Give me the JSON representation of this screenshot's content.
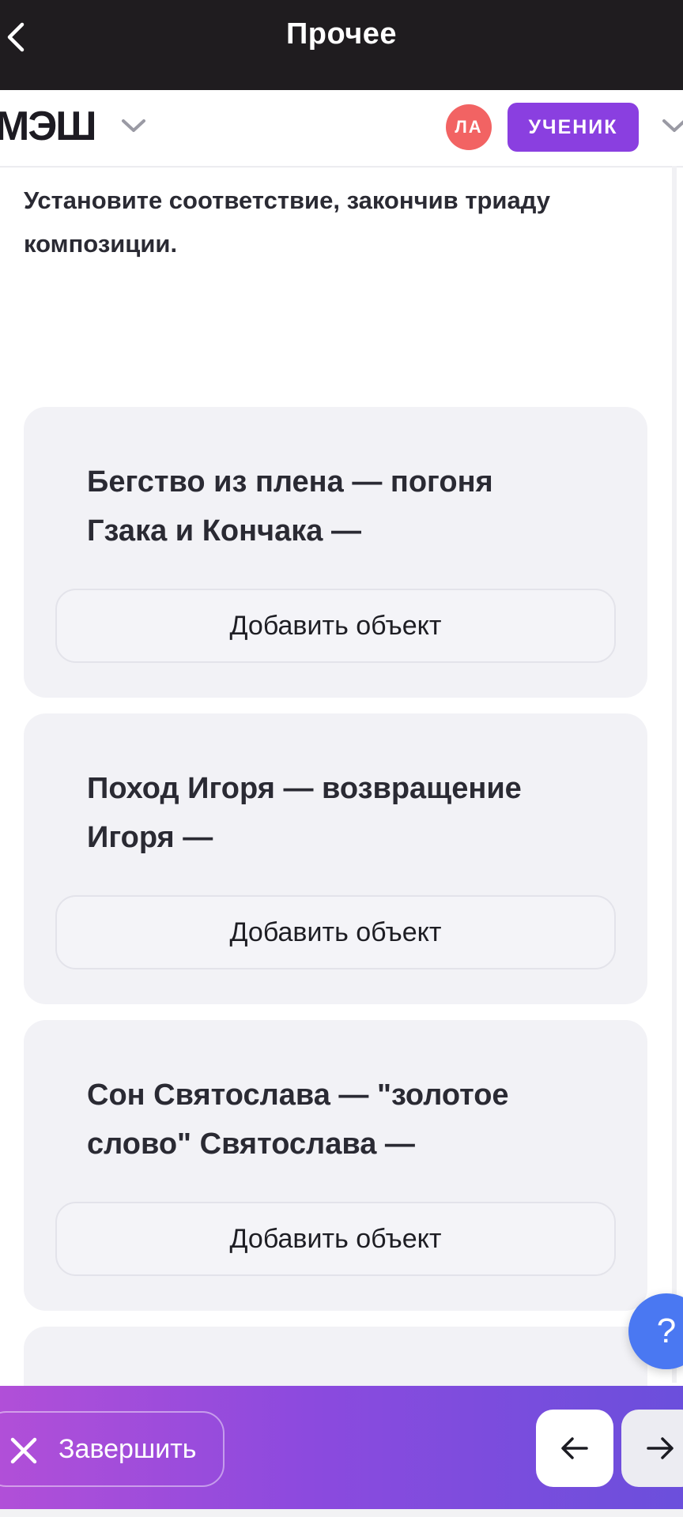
{
  "header": {
    "title": "Прочее"
  },
  "app": {
    "logo": "МЭШ",
    "avatar_initials": "ЛА",
    "role": "УЧЕНИК"
  },
  "task": {
    "question": "Установите соответствие, закончив триаду композиции.",
    "items": [
      {
        "text": "Бегство из плена — погоня Гзака и Кончака —",
        "add_label": "Добавить объект"
      },
      {
        "text": "Поход Игоря — возвращение Игоря —",
        "add_label": "Добавить объект"
      },
      {
        "text": "Сон Святослава — \"золотое слово\"  Святослава —",
        "add_label": "Добавить объект"
      }
    ]
  },
  "help_label": "?",
  "footer": {
    "finish_label": "Завершить"
  },
  "colors": {
    "topbar": "#1f1c1f",
    "avatar": "#f26363",
    "role": "#8a3fe0",
    "help": "#4a78f2",
    "footer_gradient": [
      "#b14fd8",
      "#6b4fdc"
    ]
  }
}
